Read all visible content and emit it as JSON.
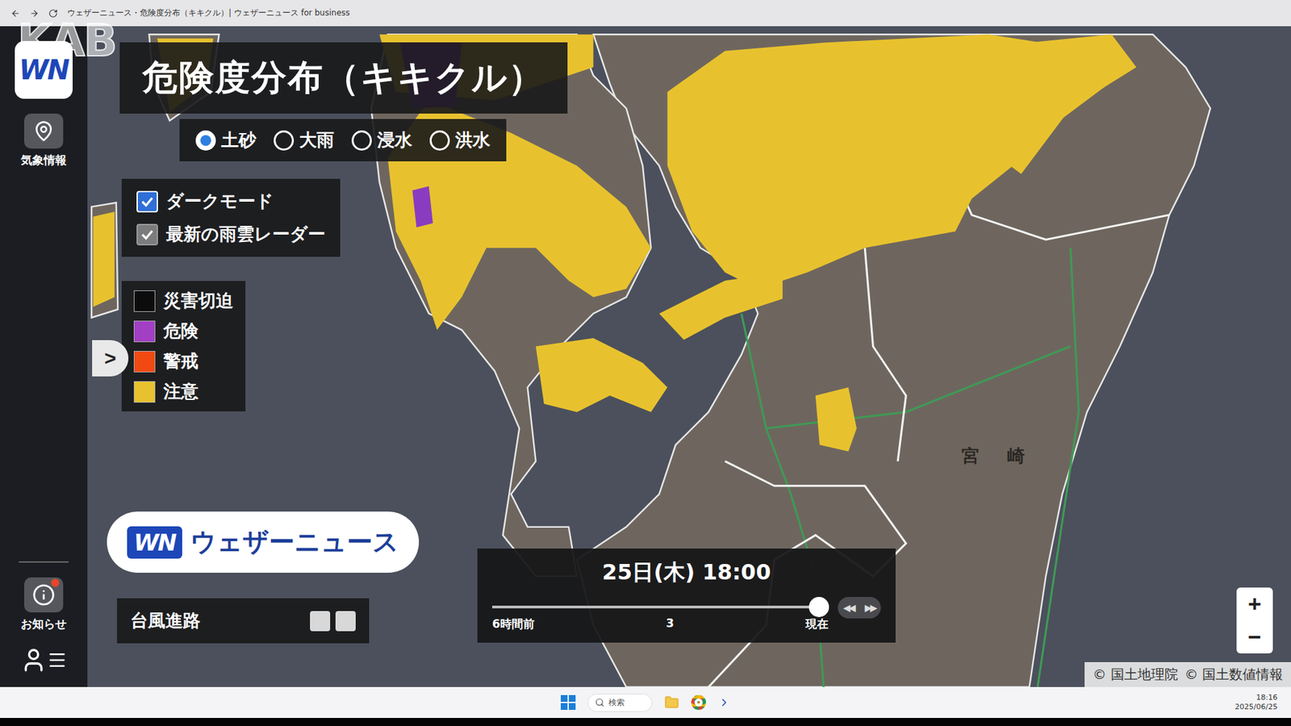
{
  "browser": {
    "title": "ウェザーニュース・危険度分布（キキクル）| ウェザーニュース for business"
  },
  "watermark": "KAB",
  "sidebar": {
    "logo": "WN",
    "items": [
      {
        "label": "気象情報"
      }
    ],
    "bottom": [
      {
        "label": "お知らせ",
        "badge": true
      }
    ]
  },
  "panel": {
    "title": "危険度分布（キキクル）",
    "layers": [
      {
        "label": "土砂",
        "selected": true
      },
      {
        "label": "大雨",
        "selected": false
      },
      {
        "label": "浸水",
        "selected": false
      },
      {
        "label": "洪水",
        "selected": false
      }
    ],
    "options": [
      {
        "label": "ダークモード",
        "checked": true,
        "disabled": false
      },
      {
        "label": "最新の雨雲レーダー",
        "checked": true,
        "disabled": true
      }
    ],
    "legend": [
      {
        "label": "災害切迫",
        "color": "#0c0c0c"
      },
      {
        "label": "危険",
        "color": "#a23fc4"
      },
      {
        "label": "警戒",
        "color": "#f04a12"
      },
      {
        "label": "注意",
        "color": "#e8c22e"
      }
    ]
  },
  "expand": ">",
  "brand": {
    "logo": "WN",
    "name": "ウェザーニュース"
  },
  "typhoon": {
    "label": "台風進路",
    "buttons": [
      {
        "disabled": true
      },
      {
        "disabled": true
      }
    ]
  },
  "timeline": {
    "time": "25日(木) 18:00",
    "start": "6時間前",
    "mid": "3",
    "end": "現在",
    "level": 1,
    "controls": [
      "◀◀",
      "▶▶"
    ]
  },
  "zoom": [
    "+",
    "−"
  ],
  "attribution": [
    "© 国土地理院",
    "© 国土数値情報"
  ],
  "map": {
    "labels": [
      {
        "text": "宮　崎"
      }
    ]
  },
  "taskbar": {
    "search": "検索",
    "time": "18:16",
    "date": "2025/06/25"
  }
}
